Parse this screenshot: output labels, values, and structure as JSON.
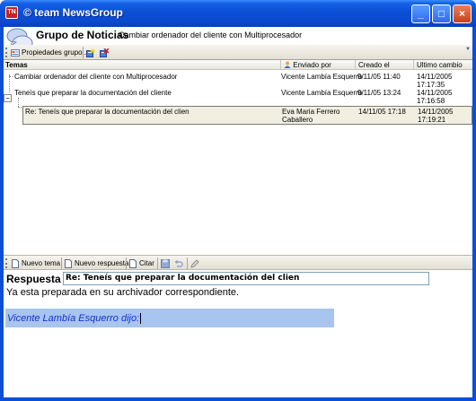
{
  "window": {
    "title": "© team NewsGroup",
    "icon_text": "TN",
    "buttons": {
      "minimize": "_",
      "maximize": "□",
      "close": "×"
    }
  },
  "header": {
    "title": "Grupo de Noticias",
    "subtitle": "Cambiar ordenador del cliente con Multiprocesador"
  },
  "top_toolbar": {
    "properties_label": "Propiedades grupo...",
    "icons": [
      "properties-icon",
      "add-group-icon",
      "delete-group-icon"
    ]
  },
  "grid": {
    "columns": [
      "Temas",
      "Enviado por",
      "Creado el",
      "Ultimo cambio"
    ],
    "rows": [
      {
        "tema": "Cambiar ordenador del cliente con Multiprocesador",
        "enviado": "Vicente Lambía Esquerro",
        "creado": "9/11/05 11:40",
        "cambio_1": "14/11/2005",
        "cambio_2": "17:17:35"
      },
      {
        "tema": "Teneís que preparar la documentación del cliente",
        "enviado": "Vicente Lambía Esquerro",
        "creado": "9/11/05 13:24",
        "cambio_1": "14/11/2005",
        "cambio_2": "17:16:58"
      },
      {
        "tema": "Re: Teneís que preparar la documentación del clien",
        "enviado_1": "Eva Maria Ferrero",
        "enviado_2": "Caballero",
        "creado": "14/11/05 17:18",
        "cambio_1": "14/11/2005",
        "cambio_2": "17:19:21"
      }
    ]
  },
  "bottom_toolbar": {
    "new_topic": "Nuevo tema",
    "new_reply": "Nuevo respuesta",
    "quote": "Citar"
  },
  "response": {
    "label": "Respuesta",
    "subject": "Re: Teneís que preparar la documentación del clien",
    "body": "Ya esta preparada en su archivador correspondiente.",
    "quote_line": "Vicente Lambía Esquerro dijo:"
  },
  "colors": {
    "titlebar": "#0a4fd4",
    "selected_row": "#f1efe2",
    "quote_highlight": "#a7c5ee",
    "quote_text": "#1a2fc8"
  }
}
